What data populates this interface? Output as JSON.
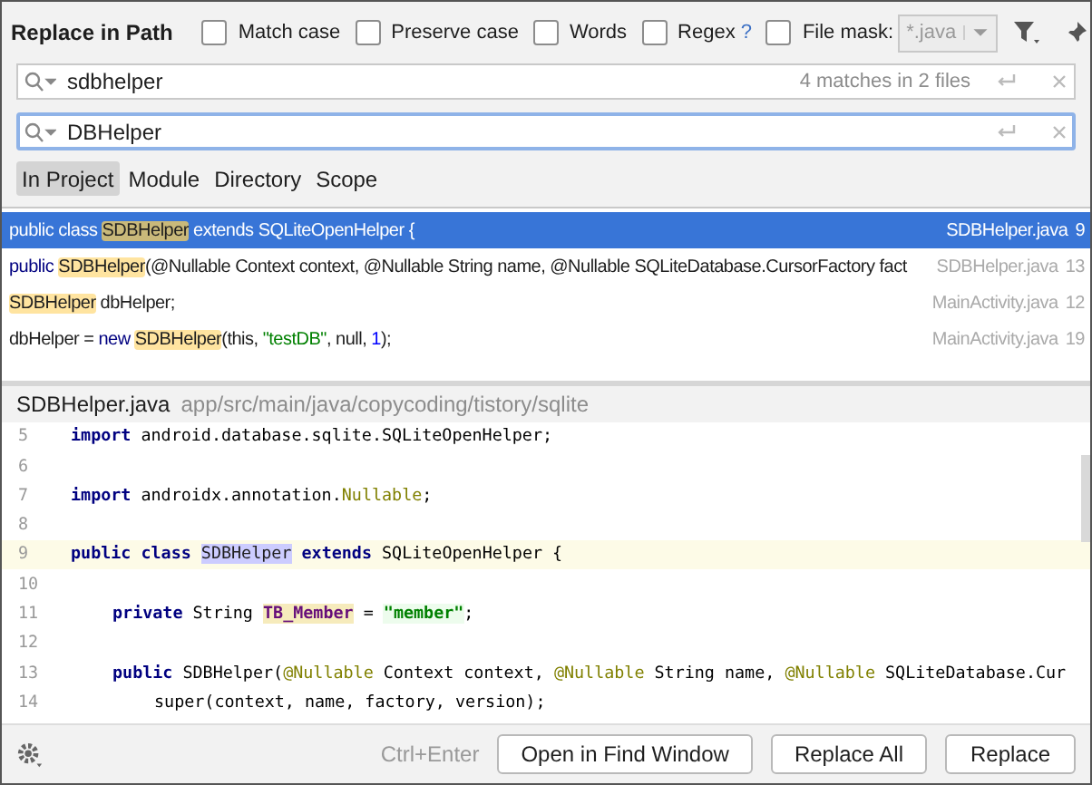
{
  "dialog": {
    "title": "Replace in Path"
  },
  "options": [
    {
      "label": "Match case",
      "checked": false
    },
    {
      "label": "Preserve case",
      "checked": false
    },
    {
      "label": "Words",
      "checked": false
    },
    {
      "label": "Regex",
      "checked": false,
      "help": "?"
    }
  ],
  "file_mask": {
    "label": "File mask:",
    "checked": false,
    "value": "*.java"
  },
  "search": {
    "value": "sdbhelper",
    "summary": "4 matches in 2 files"
  },
  "replace": {
    "value": "DBHelper"
  },
  "scopes": [
    {
      "label": "In Project",
      "selected": true
    },
    {
      "label": "Module",
      "selected": false
    },
    {
      "label": "Directory",
      "selected": false
    },
    {
      "label": "Scope",
      "selected": false
    }
  ],
  "results": [
    {
      "selected": true,
      "file": "SDBHelper.java",
      "line": "9",
      "segments": [
        {
          "kind": "text",
          "text": "public class "
        },
        {
          "kind": "match",
          "text": "SDBHelper"
        },
        {
          "kind": "text",
          "text": " extends SQLiteOpenHelper {"
        }
      ]
    },
    {
      "selected": false,
      "file": "SDBHelper.java",
      "line": "13",
      "segments": [
        {
          "kind": "keyword",
          "text": "public "
        },
        {
          "kind": "match",
          "text": "SDBHelper"
        },
        {
          "kind": "text",
          "text": "(@Nullable Context context, @Nullable String name, @Nullable SQLiteDatabase.CursorFactory fact"
        }
      ]
    },
    {
      "selected": false,
      "file": "MainActivity.java",
      "line": "12",
      "segments": [
        {
          "kind": "match",
          "text": "SDBHelper"
        },
        {
          "kind": "text",
          "text": " dbHelper;"
        }
      ]
    },
    {
      "selected": false,
      "file": "MainActivity.java",
      "line": "19",
      "segments": [
        {
          "kind": "text",
          "text": "dbHelper = "
        },
        {
          "kind": "keyword",
          "text": "new "
        },
        {
          "kind": "match",
          "text": "SDBHelper"
        },
        {
          "kind": "text",
          "text": "(this, "
        },
        {
          "kind": "string",
          "text": "\"testDB\""
        },
        {
          "kind": "text",
          "text": ", null, "
        },
        {
          "kind": "number",
          "text": "1"
        },
        {
          "kind": "text",
          "text": ");"
        }
      ]
    }
  ],
  "preview": {
    "file": "SDBHelper.java",
    "path": "app/src/main/java/copycoding/tistory/sqlite",
    "lines": [
      {
        "number": "5",
        "current": false,
        "segments": [
          {
            "kind": "keyword",
            "text": "import "
          },
          {
            "kind": "text",
            "text": "android.database.sqlite.SQLiteOpenHelper;"
          }
        ]
      },
      {
        "number": "6",
        "current": false
      },
      {
        "number": "7",
        "current": false,
        "segments": [
          {
            "kind": "keyword",
            "text": "import "
          },
          {
            "kind": "text",
            "text": "androidx.annotation."
          },
          {
            "kind": "annotation",
            "text": "Nullable"
          },
          {
            "kind": "text",
            "text": ";"
          }
        ]
      },
      {
        "number": "8",
        "current": false
      },
      {
        "number": "9",
        "current": true,
        "segments": [
          {
            "kind": "keyword",
            "text": "public class "
          },
          {
            "kind": "occurrence",
            "text": "SDBHelper"
          },
          {
            "kind": "keyword",
            "text": " extends "
          },
          {
            "kind": "text",
            "text": "SQLiteOpenHelper {"
          }
        ]
      },
      {
        "number": "10",
        "current": false
      },
      {
        "number": "11",
        "current": false,
        "segments": [
          {
            "kind": "indent1"
          },
          {
            "kind": "keyword",
            "text": "private "
          },
          {
            "kind": "text",
            "text": "String "
          },
          {
            "kind": "field",
            "text": "TB_Member"
          },
          {
            "kind": "text",
            "text": " = "
          },
          {
            "kind": "string",
            "text": "\"member\""
          },
          {
            "kind": "text",
            "text": ";"
          }
        ]
      },
      {
        "number": "12",
        "current": false
      },
      {
        "number": "13",
        "current": false,
        "segments": [
          {
            "kind": "indent1"
          },
          {
            "kind": "keyword",
            "text": "public "
          },
          {
            "kind": "text",
            "text": "SDBHelper("
          },
          {
            "kind": "annotation",
            "text": "@Nullable"
          },
          {
            "kind": "text",
            "text": " Context context, "
          },
          {
            "kind": "annotation",
            "text": "@Nullable"
          },
          {
            "kind": "text",
            "text": " String name, "
          },
          {
            "kind": "annotation",
            "text": "@Nullable"
          },
          {
            "kind": "text",
            "text": " SQLiteDatabase.Cur"
          }
        ]
      },
      {
        "number": "14",
        "current": false,
        "segments": [
          {
            "kind": "indent2"
          },
          {
            "kind": "text",
            "text": "super(context, name, factory, version);"
          }
        ]
      }
    ]
  },
  "footer": {
    "shortcut": "Ctrl+Enter",
    "buttons": [
      "Open in Find Window",
      "Replace All",
      "Replace"
    ]
  }
}
